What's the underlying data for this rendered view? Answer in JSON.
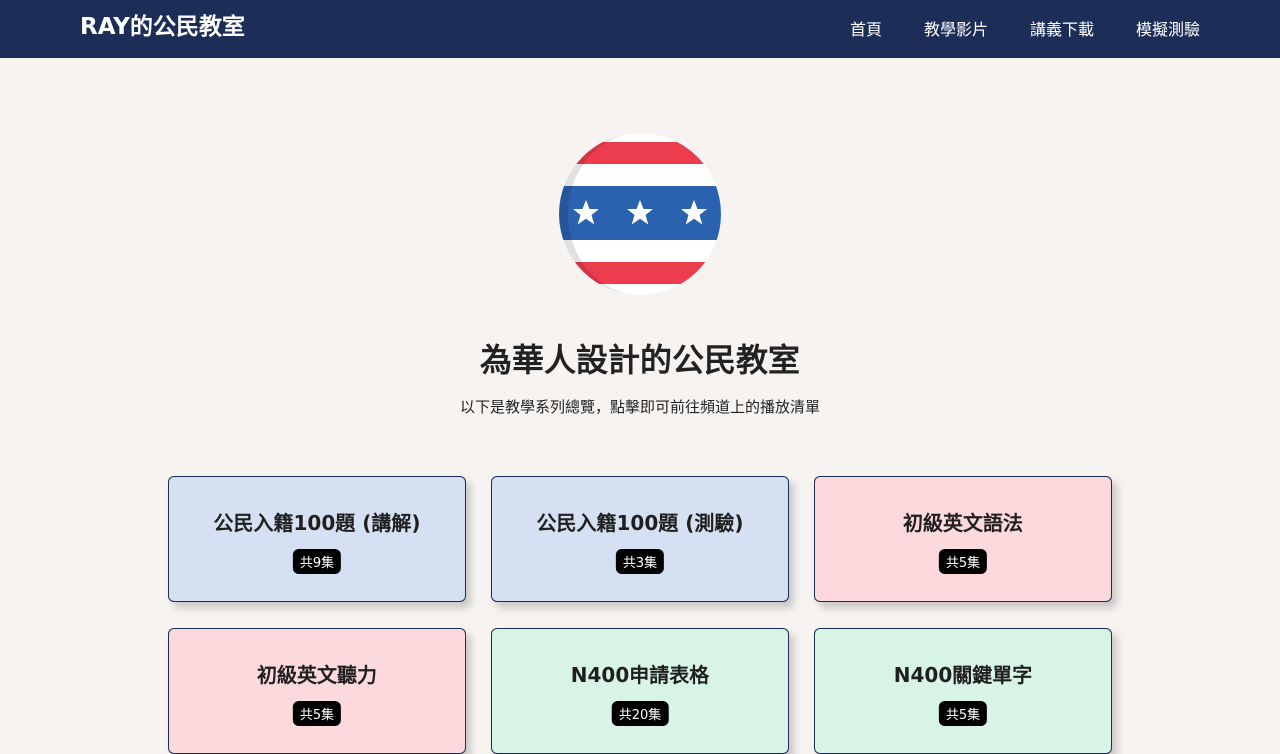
{
  "navbar": {
    "brand": "RAY的公民教室",
    "links": [
      "首頁",
      "教學影片",
      "講義下載",
      "模擬測驗"
    ]
  },
  "hero": {
    "logo_icon": "us-flag-stars-stripes-icon",
    "title": "為華人設計的公民教室",
    "subtitle": "以下是教學系列總覽，點擊即可前往頻道上的播放清單"
  },
  "cards": [
    {
      "title": "公民入籍100題 (講解)",
      "badge": "共9集",
      "color": "#d5e1f2"
    },
    {
      "title": "公民入籍100題 (測驗)",
      "badge": "共3集",
      "color": "#d5e1f2"
    },
    {
      "title": "初級英文語法",
      "badge": "共5集",
      "color": "#fbd9dd"
    },
    {
      "title": "初級英文聽力",
      "badge": "共5集",
      "color": "#fbd9dd"
    },
    {
      "title": "N400申請表格",
      "badge": "共20集",
      "color": "#d8f4e7"
    },
    {
      "title": "N400關鍵單字",
      "badge": "共5集",
      "color": "#d8f4e7"
    }
  ],
  "colors": {
    "navbar_bg": "#1c2e58",
    "page_bg": "#f6f3f1",
    "flag_red": "#ec3d4f",
    "flag_blue": "#2b62b0"
  }
}
